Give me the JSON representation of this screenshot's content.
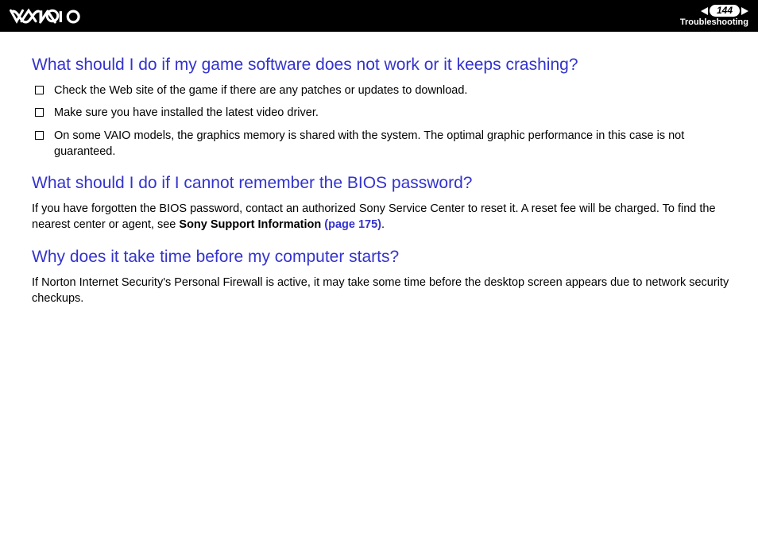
{
  "header": {
    "page_number": "144",
    "section": "Troubleshooting"
  },
  "sections": [
    {
      "heading": "What should I do if my game software does not work or it keeps crashing?",
      "bullets": [
        "Check the Web site of the game if there are any patches or updates to download.",
        "Make sure you have installed the latest video driver.",
        "On some VAIO models, the graphics memory is shared with the system. The optimal graphic performance in this case is not guaranteed."
      ]
    },
    {
      "heading": "What should I do if I cannot remember the BIOS password?",
      "para_prefix": "If you have forgotten the BIOS password, contact an authorized Sony Service Center to reset it. A reset fee will be charged. To find the nearest center or agent, see ",
      "para_bold": "Sony Support Information ",
      "para_link": "(page 175)",
      "para_suffix": "."
    },
    {
      "heading": "Why does it take time before my computer starts?",
      "para": "If Norton Internet Security's Personal Firewall is active, it may take some time before the desktop screen appears due to network security checkups."
    }
  ]
}
